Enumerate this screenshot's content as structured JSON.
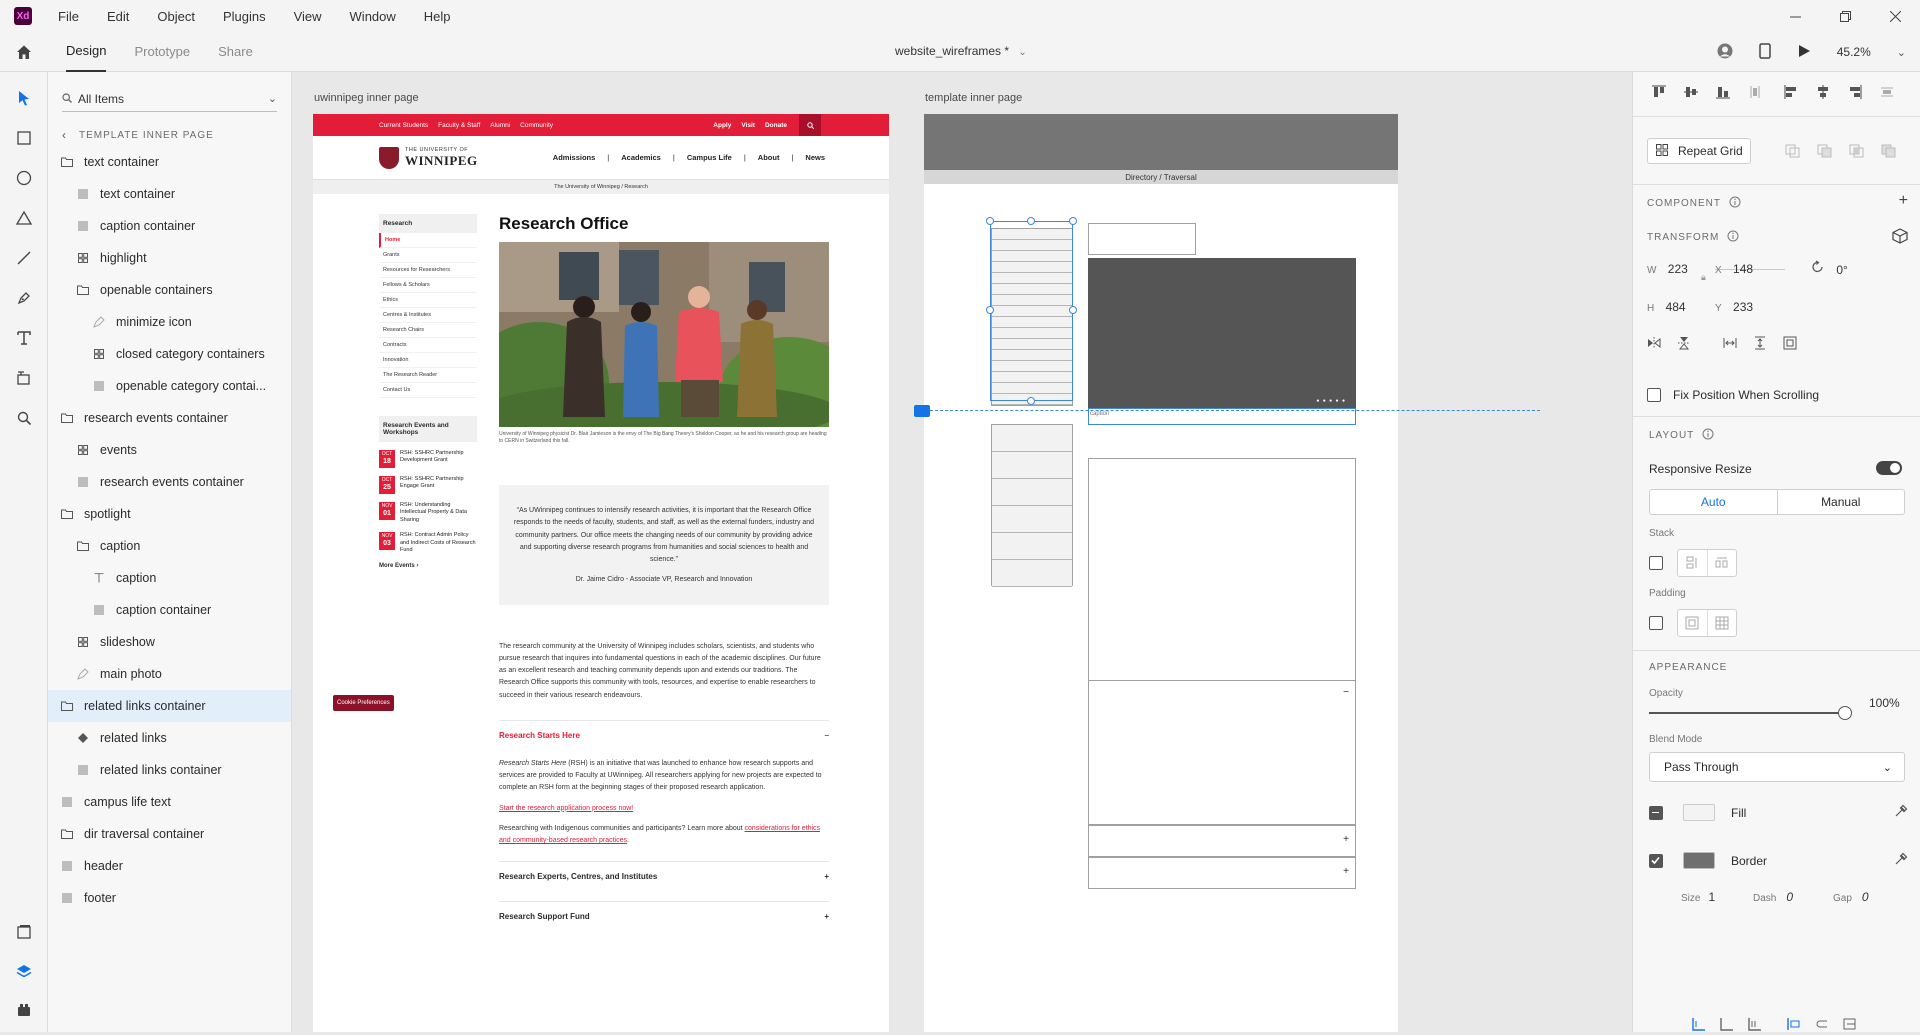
{
  "app": {
    "logo": "Xd",
    "menu": [
      "File",
      "Edit",
      "Object",
      "Plugins",
      "View",
      "Window",
      "Help"
    ]
  },
  "toolbar": {
    "tabs": [
      "Design",
      "Prototype",
      "Share"
    ],
    "doc_title": "website_wireframes *",
    "zoom": "45.2%"
  },
  "layers": {
    "search_label": "All Items",
    "breadcrumb": "TEMPLATE INNER PAGE",
    "items": [
      {
        "label": "text container",
        "indent": 0,
        "icon": "folder-icon"
      },
      {
        "label": "text container",
        "indent": 1,
        "icon": "rectangle-icon"
      },
      {
        "label": "caption container",
        "indent": 1,
        "icon": "rectangle-icon"
      },
      {
        "label": "highlight",
        "indent": 1,
        "icon": "repeat-grid-icon"
      },
      {
        "label": "openable containers",
        "indent": 1,
        "icon": "folder-icon"
      },
      {
        "label": "minimize icon",
        "indent": 2,
        "icon": "pen-path-icon"
      },
      {
        "label": "closed category containers",
        "indent": 2,
        "icon": "repeat-grid-icon"
      },
      {
        "label": "openable category contai...",
        "indent": 2,
        "icon": "rectangle-icon"
      },
      {
        "label": "research events container",
        "indent": 0,
        "icon": "folder-icon"
      },
      {
        "label": "events",
        "indent": 1,
        "icon": "repeat-grid-icon"
      },
      {
        "label": "research events container",
        "indent": 1,
        "icon": "rectangle-icon"
      },
      {
        "label": "spotlight",
        "indent": 0,
        "icon": "folder-icon"
      },
      {
        "label": "caption",
        "indent": 1,
        "icon": "folder-icon"
      },
      {
        "label": "caption",
        "indent": 2,
        "icon": "text-icon"
      },
      {
        "label": "caption container",
        "indent": 2,
        "icon": "rectangle-icon"
      },
      {
        "label": "slideshow",
        "indent": 1,
        "icon": "repeat-grid-icon"
      },
      {
        "label": "main photo",
        "indent": 1,
        "icon": "pen-path-icon"
      },
      {
        "label": "related links container",
        "indent": 0,
        "icon": "folder-icon",
        "selected": true
      },
      {
        "label": "related links",
        "indent": 1,
        "icon": "component-icon"
      },
      {
        "label": "related links container",
        "indent": 1,
        "icon": "rectangle-icon"
      },
      {
        "label": "campus life text",
        "indent": 0,
        "icon": "rectangle-icon"
      },
      {
        "label": "dir traversal container",
        "indent": 0,
        "icon": "folder-icon"
      },
      {
        "label": "header",
        "indent": 0,
        "icon": "rectangle-icon"
      },
      {
        "label": "footer",
        "indent": 0,
        "icon": "rectangle-icon"
      }
    ]
  },
  "artboards": {
    "uw_label": "uwinnipeg inner page",
    "wf_label": "template inner page"
  },
  "uw": {
    "top_links": [
      "Current Students",
      "Faculty & Staff",
      "Alumni",
      "Community"
    ],
    "top_actions": [
      "Apply",
      "Visit",
      "Donate"
    ],
    "logo_small": "THE UNIVERSITY OF",
    "logo_big": "WINNIPEG",
    "nav": [
      "Admissions",
      "|",
      "Academics",
      "|",
      "Campus Life",
      "|",
      "About",
      "|",
      "News"
    ],
    "breadcrumb": "The University of Winnipeg  /  Research",
    "side_heading": "Research",
    "side_items": [
      "Home",
      "Grants",
      "Resources for Researchers",
      "Fellows & Scholars",
      "Ethics",
      "Centres & Institutes",
      "Research Chairs",
      "Contracts",
      "Innovation",
      "The Research Reader",
      "Contact Us"
    ],
    "events_heading": "Research Events and Workshops",
    "events": [
      {
        "month": "OCT",
        "day": "18",
        "title": "RSH: SSHRC Partnership Development Grant"
      },
      {
        "month": "OCT",
        "day": "25",
        "title": "RSH: SSHRC Partnership Engage Grant"
      },
      {
        "month": "NOV",
        "day": "01",
        "title": "RSH: Understanding Intellectual Property & Data Sharing"
      },
      {
        "month": "NOV",
        "day": "03",
        "title": "RSH: Contract Admin Policy and Indirect Costs of Research Fund"
      }
    ],
    "more_events": "More Events  ›",
    "cookie": "Cookie Preferences",
    "title": "Research Office",
    "photo_caption": "University of Winnipeg physicist Dr. Blair Jamieson is the envy of The Big Bang Theory's Sheldon Cooper, as he and his research group are heading to CERN in Switzerland this fall.",
    "quote": "“As UWinnipeg continues to intensify research activities, it is important that the Research Office responds to the needs of faculty, students, and staff, as well as the external funders, industry and community partners. Our office meets the changing needs of our community by providing advice and supporting diverse research programs from humanities and social sciences to health and science.”",
    "quote_by": "Dr. Jaime Cidro - Associate VP, Research and Innovation",
    "body": "The research community at the University of Winnipeg includes scholars, scientists, and students who pursue research that inquires into fundamental questions in each of the academic disciplines. Our future as an excellent research and teaching community depends upon and extends our traditions. The Research Office supports this community with tools, resources, and expertise to enable researchers to succeed in their various research endeavours.",
    "acc1_title": "Research Starts Here",
    "acc1_body_em": "Research Starts Here",
    "acc1_body": " (RSH) is an initiative that was launched to enhance how research supports and services are provided to Faculty at UWinnipeg. All researchers applying for new projects are expected to complete an RSH form at the beginning stages of their proposed research application.",
    "acc1_link": "Start the research application process now!",
    "acc1_more": "Researching with Indigenous communities and participants? Learn more about ",
    "acc1_more_link": "considerations for ethics and community-based research practices",
    "acc2_title": "Research Experts, Centres, and Institutes",
    "acc3_title": "Research Support Fund",
    "minus": "−",
    "plus": "+"
  },
  "wf": {
    "breadcrumb": "Directory  /  Traversal",
    "caption": "caption",
    "dots": "● ● ● ● ●",
    "minus": "−",
    "plus": "+"
  },
  "props": {
    "repeat_grid": "Repeat Grid",
    "component": "COMPONENT",
    "transform": "TRANSFORM",
    "w_label": "W",
    "w": "223",
    "x_label": "X",
    "x": "148",
    "rot": "0°",
    "h_label": "H",
    "h": "484",
    "y_label": "Y",
    "y": "233",
    "fix_position": "Fix Position When Scrolling",
    "layout": "LAYOUT",
    "responsive": "Responsive Resize",
    "auto": "Auto",
    "manual": "Manual",
    "stack": "Stack",
    "padding": "Padding",
    "appearance": "APPEARANCE",
    "opacity_label": "Opacity",
    "opacity": "100%",
    "opacity_level": 1.0,
    "blend_label": "Blend Mode",
    "blend": "Pass Through",
    "fill": "Fill",
    "border": "Border",
    "size_label": "Size",
    "size": "1",
    "dash_label": "Dash",
    "dash": "0",
    "gap_label": "Gap",
    "gap": "0"
  },
  "colors": {
    "accent": "#1473e6",
    "uw_red": "#e21d37",
    "wf_dark": "#555555"
  }
}
